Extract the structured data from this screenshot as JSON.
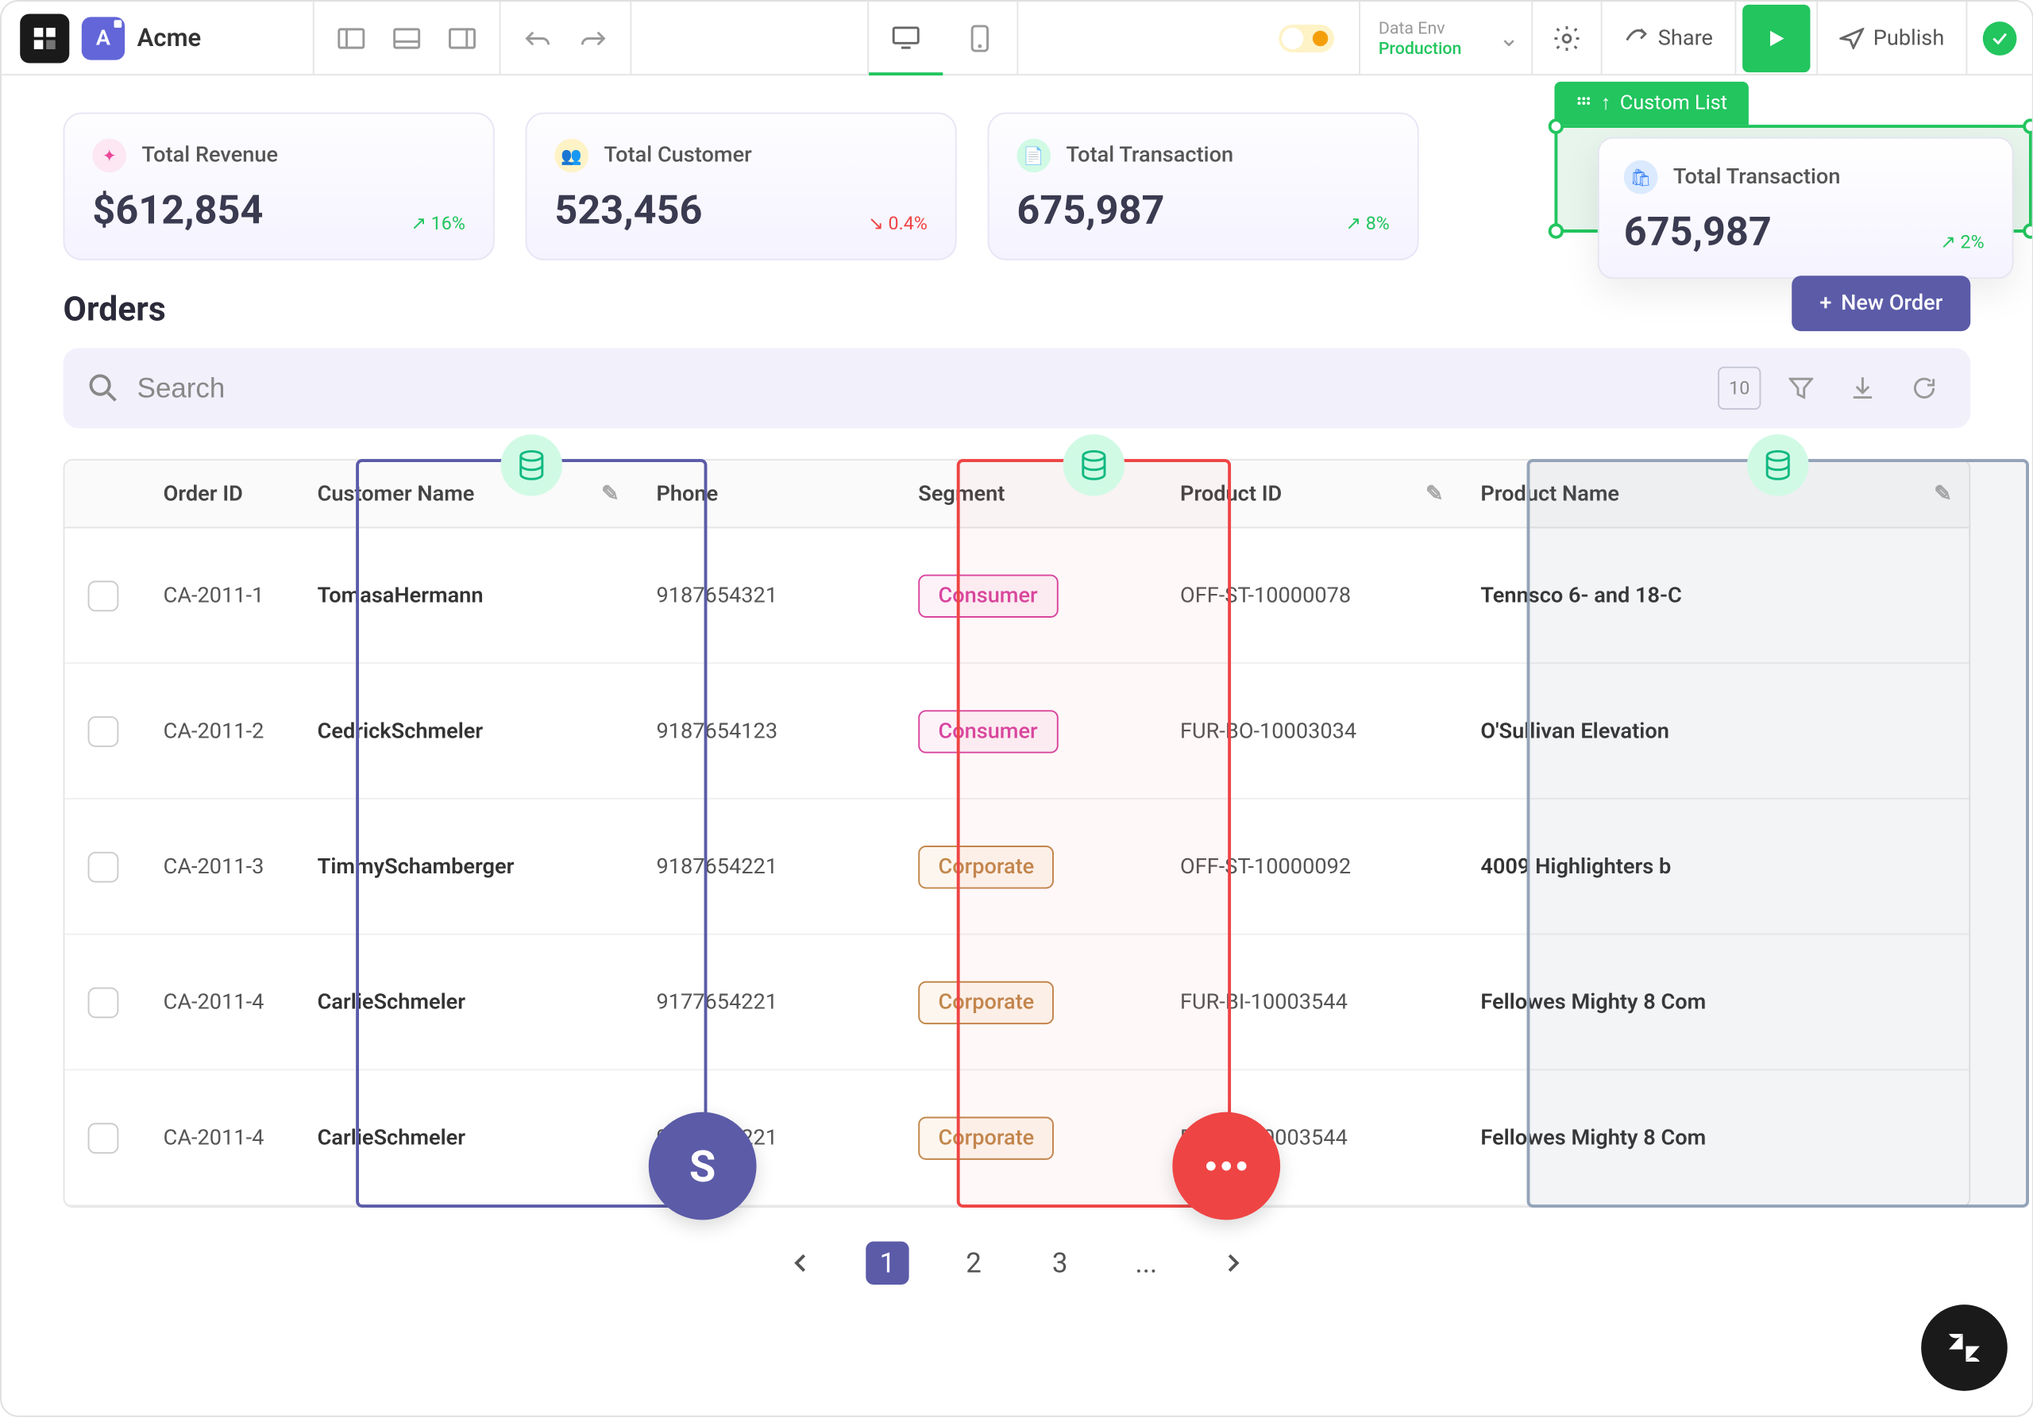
{
  "header": {
    "appName": "Acme",
    "appInitial": "A",
    "envLabel": "Data Env",
    "envValue": "Production",
    "share": "Share",
    "publish": "Publish"
  },
  "stats": [
    {
      "title": "Total Revenue",
      "value": "$612,854",
      "trend": "16%",
      "dir": "up",
      "icon": "pink"
    },
    {
      "title": "Total Customer",
      "value": "523,456",
      "trend": "0.4%",
      "dir": "down",
      "icon": "yellow"
    },
    {
      "title": "Total Transaction",
      "value": "675,987",
      "trend": "8%",
      "dir": "up",
      "icon": "green"
    }
  ],
  "customList": {
    "label": "Custom List",
    "floatTitle": "Total Transaction",
    "floatValue": "675,987",
    "floatTrend": "2%"
  },
  "section": {
    "title": "Orders",
    "newOrder": "New Order"
  },
  "search": {
    "placeholder": "Search",
    "pageSize": "10"
  },
  "columns": {
    "orderId": "Order ID",
    "customerName": "Customer Name",
    "phone": "Phone",
    "segment": "Segment",
    "productId": "Product ID",
    "productName": "Product Name"
  },
  "rows": [
    {
      "id": "CA-2011-1",
      "name": "TomasaHermann",
      "phone": "9187654321",
      "segment": "Consumer",
      "segClass": "consumer",
      "pid": "OFF-ST-10000078",
      "pname": "Tennsco 6- and 18-C"
    },
    {
      "id": "CA-2011-2",
      "name": "CedrickSchmeler",
      "phone": "9187654123",
      "segment": "Consumer",
      "segClass": "consumer",
      "pid": "FUR-BO-10003034",
      "pname": "O'Sullivan Elevation"
    },
    {
      "id": "CA-2011-3",
      "name": "TimmySchamberger",
      "phone": "9187654221",
      "segment": "Corporate",
      "segClass": "corporate",
      "pid": "OFF-ST-10000092",
      "pname": "4009 Highlighters b"
    },
    {
      "id": "CA-2011-4",
      "name": "CarlieSchmeler",
      "phone": "9177654221",
      "segment": "Corporate",
      "segClass": "corporate",
      "pid": "FUR-BI-10003544",
      "pname": "Fellowes Mighty 8 Com"
    },
    {
      "id": "CA-2011-4",
      "name": "CarlieSchmeler",
      "phone": "9177654221",
      "segment": "Corporate",
      "segClass": "corporate",
      "pid": "FUR-BI-10003544",
      "pname": "Fellowes Mighty 8 Com"
    }
  ],
  "pagination": {
    "pages": [
      "1",
      "2",
      "3",
      "..."
    ],
    "active": 0
  },
  "badges": {
    "s": "S"
  }
}
